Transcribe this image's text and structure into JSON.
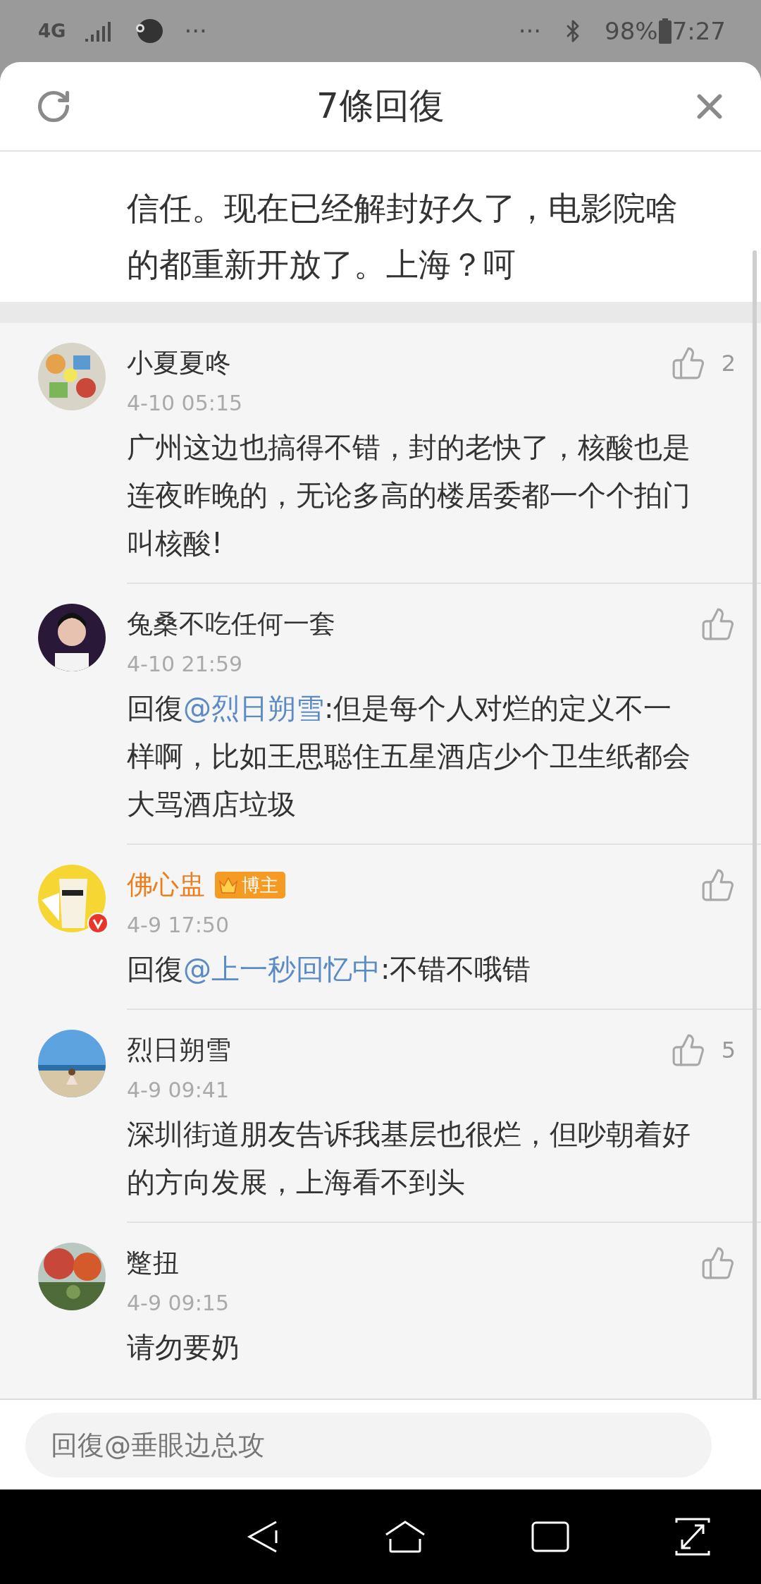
{
  "status_bar": {
    "network": "4G",
    "left_more": "···",
    "right_more": "···",
    "battery": "98%",
    "time": "7:27"
  },
  "header": {
    "title": "7條回復"
  },
  "post": {
    "text": "信任。现在已经解封好久了，电影院啥的都重新开放了。上海？呵"
  },
  "comments": [
    {
      "name": "小夏夏咚",
      "vip": false,
      "verified": false,
      "time": "4-10 05:15",
      "likes": "2",
      "text": "广州这边也搞得不错，封的老快了，核酸也是连夜昨晚的，无论多高的楼居委都一个个拍门叫核酸!"
    },
    {
      "name": "兔桑不吃任何一套",
      "vip": false,
      "verified": false,
      "time": "4-10 21:59",
      "reply_prefix": "回復",
      "mention": "@烈日朔雪",
      "text": ":但是每个人对烂的定义不一样啊，比如王思聪住五星酒店少个卫生纸都会大骂酒店垃圾"
    },
    {
      "name": "佛心盅",
      "vip": true,
      "verified": true,
      "badge": "博主",
      "time": "4-9 17:50",
      "reply_prefix": "回復",
      "mention": "@上一秒回忆中",
      "text": ":不错不哦错"
    },
    {
      "name": "烈日朔雪",
      "vip": false,
      "verified": false,
      "time": "4-9 09:41",
      "likes": "5",
      "text": "深圳街道朋友告诉我基层也很烂，但吵朝着好的方向发展，上海看不到头"
    },
    {
      "name": "蹩扭",
      "vip": false,
      "verified": false,
      "time": "4-9 09:15",
      "text": "请勿要奶"
    }
  ],
  "reply_box": {
    "placeholder": "回復@垂眼边总攻"
  }
}
